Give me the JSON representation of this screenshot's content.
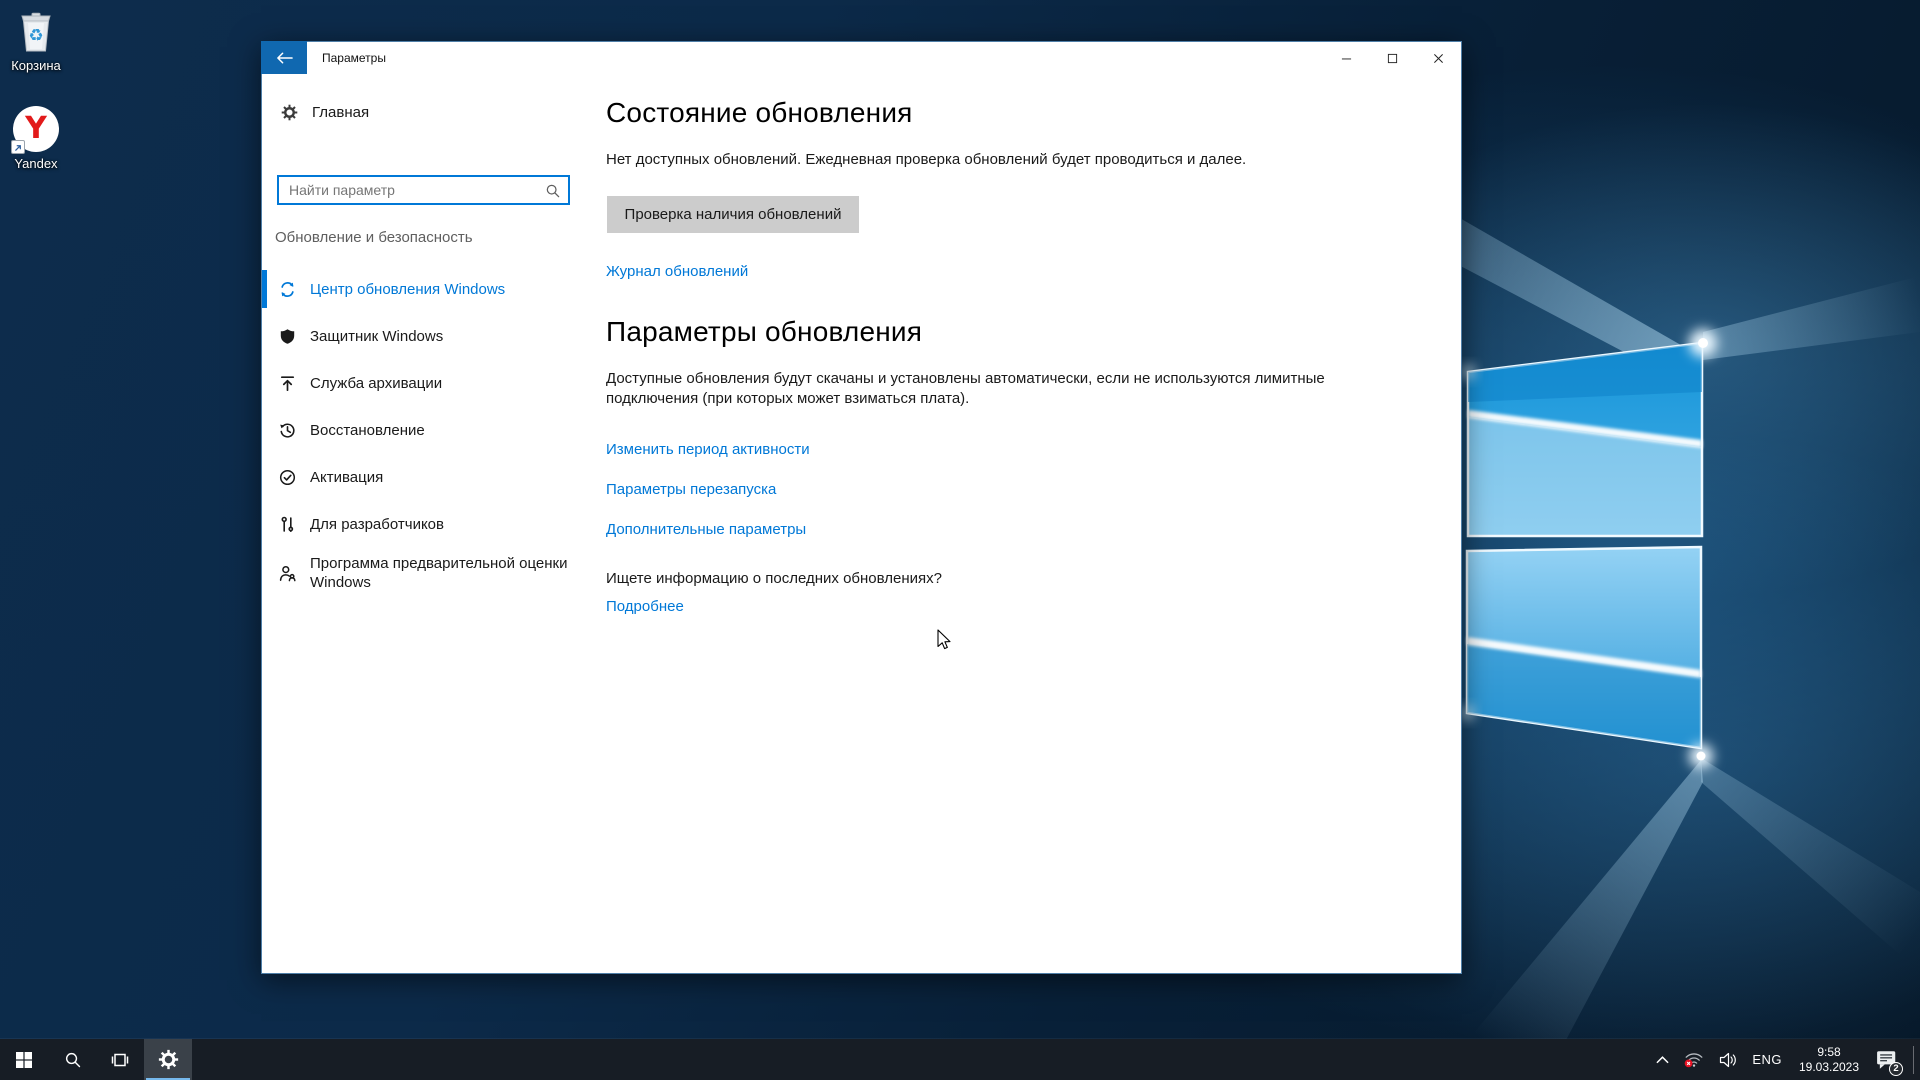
{
  "desktop": {
    "icons": [
      {
        "label": "Корзина"
      },
      {
        "label": "Yandex"
      }
    ],
    "recycle_glyph": "♻",
    "yandex_letter": "Y"
  },
  "window": {
    "title": "Параметры",
    "sidebar": {
      "home_label": "Главная",
      "search_placeholder": "Найти параметр",
      "section_label": "Обновление и безопасность",
      "items": [
        {
          "label": "Центр обновления Windows",
          "icon": "sync-icon",
          "selected": true
        },
        {
          "label": "Защитник Windows",
          "icon": "shield-icon",
          "selected": false
        },
        {
          "label": "Служба архивации",
          "icon": "backup-icon",
          "selected": false
        },
        {
          "label": "Восстановление",
          "icon": "recovery-icon",
          "selected": false
        },
        {
          "label": "Активация",
          "icon": "activation-check-icon",
          "selected": false
        },
        {
          "label": "Для разработчиков",
          "icon": "developer-tools-icon",
          "selected": false
        },
        {
          "label": "Программа предварительной оценки Windows",
          "icon": "insider-person-icon",
          "selected": false
        }
      ]
    },
    "main": {
      "status_heading": "Состояние обновления",
      "status_text": "Нет доступных обновлений. Ежедневная проверка обновлений будет проводиться и далее.",
      "check_button_label": "Проверка наличия обновлений",
      "history_link": "Журнал обновлений",
      "options_heading": "Параметры обновления",
      "options_text": "Доступные обновления будут скачаны и установлены автоматически, если не используются лимитные подключения (при которых может взиматься плата).",
      "activity_link": "Изменить период активности",
      "restart_link": "Параметры перезапуска",
      "advanced_link": "Дополнительные параметры",
      "info_question": "Ищете информацию о последних обновлениях?",
      "info_link": "Подробнее"
    }
  },
  "taskbar": {
    "language": "ENG",
    "time": "9:58",
    "date": "19.03.2023",
    "notification_count": "2"
  },
  "colors": {
    "accent": "#0078d7",
    "back_button": "#1068b0",
    "button_bg": "#cccccc",
    "taskbar_bg": "#171d25",
    "taskbar_underline": "#76b9ed",
    "badge_red": "#e81123"
  }
}
